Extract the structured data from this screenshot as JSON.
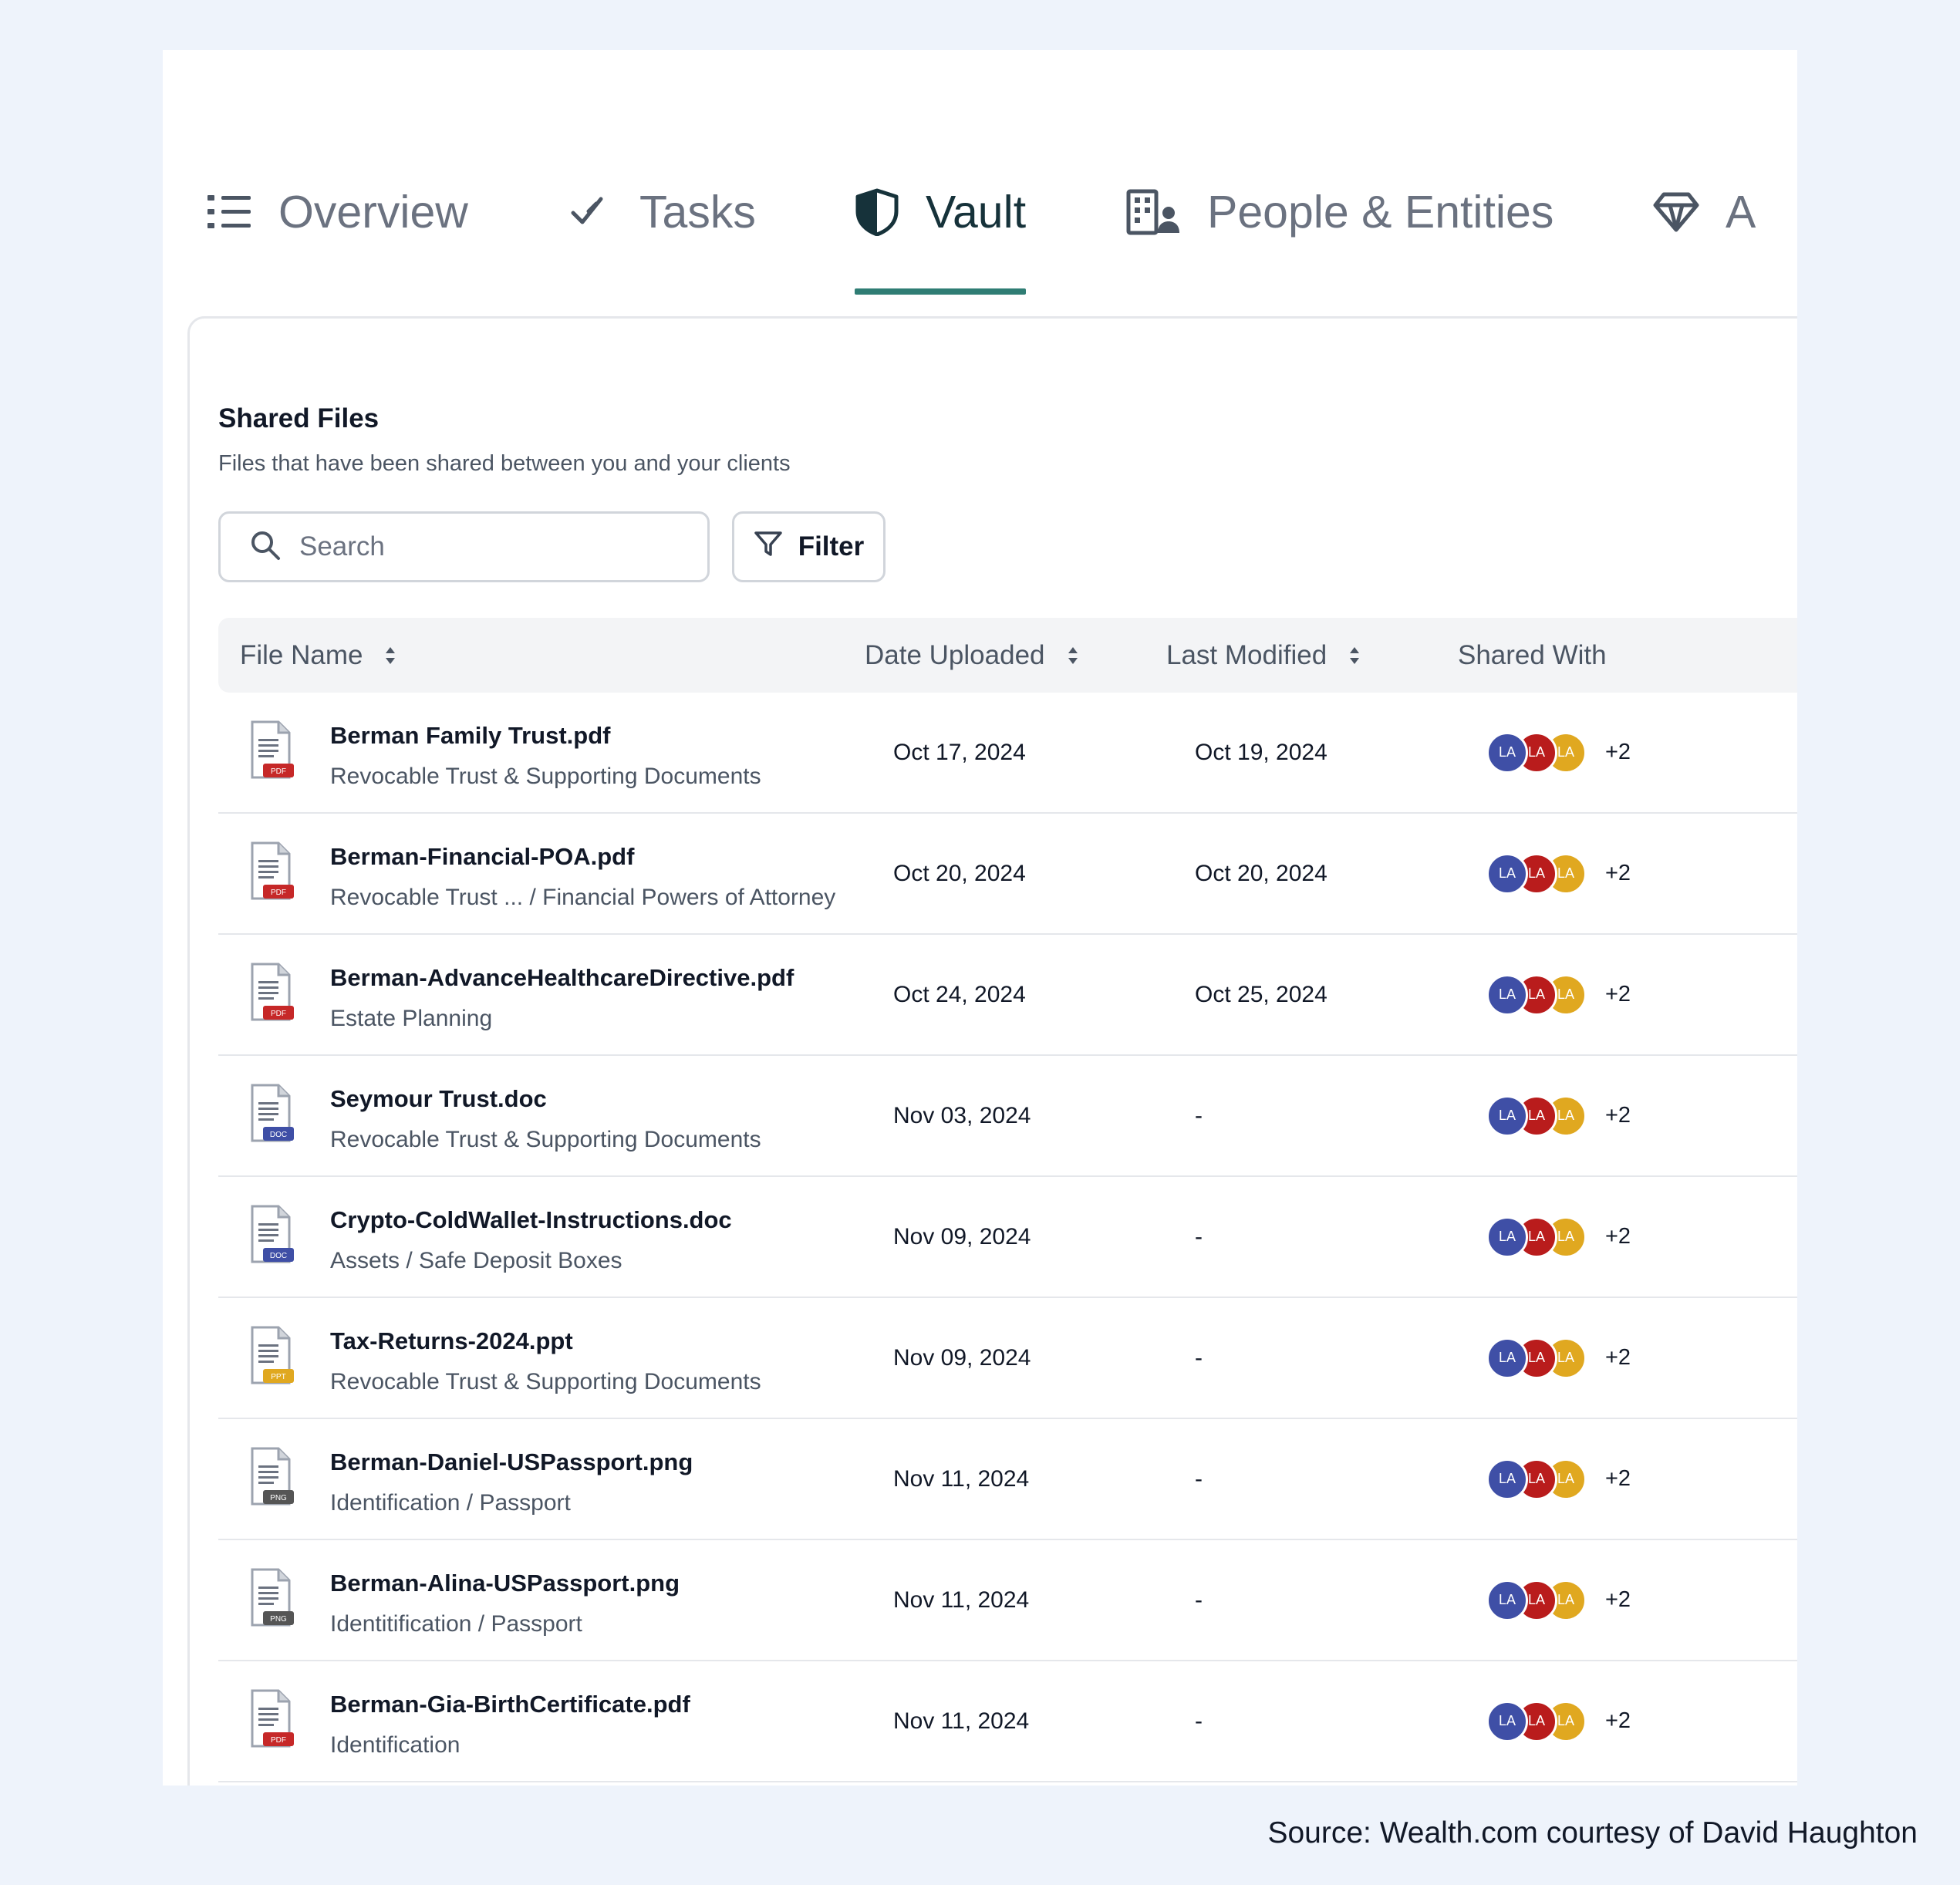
{
  "tabs": [
    {
      "label": "Overview",
      "icon": "list-icon",
      "active": false
    },
    {
      "label": "Tasks",
      "icon": "checkmark-icon",
      "active": false
    },
    {
      "label": "Vault",
      "icon": "shield-icon",
      "active": true
    },
    {
      "label": "People & Entities",
      "icon": "building-person-icon",
      "active": false
    },
    {
      "label": "A",
      "icon": "diamond-icon",
      "active": false
    }
  ],
  "panel": {
    "title": "Shared Files",
    "subtitle": "Files that have been shared between you and your clients"
  },
  "search": {
    "placeholder": "Search",
    "value": ""
  },
  "filter": {
    "label": "Filter"
  },
  "table": {
    "columns": [
      "File Name",
      "Date Uploaded",
      "Last Modified",
      "Shared With"
    ],
    "rows": [
      {
        "name": "Berman Family Trust.pdf",
        "category": "Revocable Trust & Supporting Documents",
        "type": "PDF",
        "uploaded": "Oct 17, 2024",
        "modified": "Oct 19, 2024",
        "avatars": [
          "LA",
          "LA",
          "LA"
        ],
        "more": "+2"
      },
      {
        "name": "Berman-Financial-POA.pdf",
        "category": "Revocable Trust ... / Financial Powers of Attorney",
        "type": "PDF",
        "uploaded": "Oct 20, 2024",
        "modified": "Oct 20, 2024",
        "avatars": [
          "LA",
          "LA",
          "LA"
        ],
        "more": "+2"
      },
      {
        "name": "Berman-AdvanceHealthcareDirective.pdf",
        "category": "Estate Planning",
        "type": "PDF",
        "uploaded": "Oct 24, 2024",
        "modified": "Oct 25, 2024",
        "avatars": [
          "LA",
          "LA",
          "LA"
        ],
        "more": "+2"
      },
      {
        "name": "Seymour Trust.doc",
        "category": "Revocable Trust & Supporting Documents",
        "type": "DOC",
        "uploaded": "Nov 03, 2024",
        "modified": "-",
        "avatars": [
          "LA",
          "LA",
          "LA"
        ],
        "more": "+2"
      },
      {
        "name": "Crypto-ColdWallet-Instructions.doc",
        "category": "Assets / Safe Deposit Boxes",
        "type": "DOC",
        "uploaded": "Nov 09, 2024",
        "modified": "-",
        "avatars": [
          "LA",
          "LA",
          "LA"
        ],
        "more": "+2"
      },
      {
        "name": "Tax-Returns-2024.ppt",
        "category": "Revocable Trust & Supporting Documents",
        "type": "PPT",
        "uploaded": "Nov 09, 2024",
        "modified": "-",
        "avatars": [
          "LA",
          "LA",
          "LA"
        ],
        "more": "+2"
      },
      {
        "name": "Berman-Daniel-USPassport.png",
        "category": "Identification / Passport",
        "type": "PNG",
        "uploaded": "Nov 11, 2024",
        "modified": "-",
        "avatars": [
          "LA",
          "LA",
          "LA"
        ],
        "more": "+2"
      },
      {
        "name": "Berman-Alina-USPassport.png",
        "category": "Identitification / Passport",
        "type": "PNG",
        "uploaded": "Nov 11, 2024",
        "modified": "-",
        "avatars": [
          "LA",
          "LA",
          "LA"
        ],
        "more": "+2"
      },
      {
        "name": "Berman-Gia-BirthCertificate.pdf",
        "category": "Identification",
        "type": "PDF",
        "uploaded": "Nov 11, 2024",
        "modified": "-",
        "avatars": [
          "LA",
          "LA",
          "LA"
        ],
        "more": "+2"
      }
    ]
  },
  "colors": {
    "accent": "#2f7d74",
    "pdf": "#c62828",
    "doc": "#3f4fa6",
    "ppt": "#e0a820",
    "png": "#555555",
    "avatar_blue": "#3f4fa6",
    "avatar_red": "#b91c1c",
    "avatar_gold": "#e0a820"
  },
  "caption": "Source: Wealth.com courtesy of David Haughton"
}
